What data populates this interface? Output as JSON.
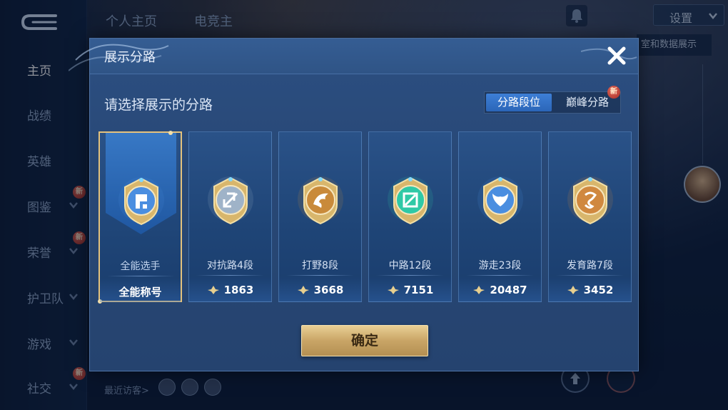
{
  "background": {
    "sidebar": [
      {
        "label": "主页",
        "active": true,
        "chevron": false,
        "badge": ""
      },
      {
        "label": "战绩",
        "active": false,
        "chevron": false,
        "badge": ""
      },
      {
        "label": "英雄",
        "active": false,
        "chevron": false,
        "badge": ""
      },
      {
        "label": "图鉴",
        "active": false,
        "chevron": true,
        "badge": "新"
      },
      {
        "label": "荣誉",
        "active": false,
        "chevron": true,
        "badge": "新"
      },
      {
        "label": "护卫队",
        "active": false,
        "chevron": true,
        "badge": ""
      },
      {
        "label": "游戏",
        "active": false,
        "chevron": true,
        "badge": ""
      },
      {
        "label": "社交",
        "active": false,
        "chevron": true,
        "badge": "新"
      }
    ],
    "top_tabs": [
      "个人主页",
      "电竞主"
    ],
    "settings_label": "设置",
    "peek_label": "室和数据展示",
    "visitors_label": "最近访客>"
  },
  "dialog": {
    "title": "展示分路",
    "subtitle": "请选择展示的分路",
    "toggle": {
      "options": [
        "分路段位",
        "巅峰分路"
      ],
      "selected": "分路段位",
      "badge": "新"
    },
    "cards": [
      {
        "name": "全能选手",
        "value": "全能称号",
        "selected": true,
        "emblem": "all-round-emblem-icon",
        "color": "#4a8ee0"
      },
      {
        "name": "对抗路4段",
        "value": "1863",
        "selected": false,
        "emblem": "clash-lane-emblem-icon",
        "color": "#9fb3c8"
      },
      {
        "name": "打野8段",
        "value": "3668",
        "selected": false,
        "emblem": "jungle-emblem-icon",
        "color": "#c98a3a"
      },
      {
        "name": "中路12段",
        "value": "7151",
        "selected": false,
        "emblem": "mid-lane-emblem-icon",
        "color": "#2fc9a6"
      },
      {
        "name": "游走23段",
        "value": "20487",
        "selected": false,
        "emblem": "roam-emblem-icon",
        "color": "#4a8ee0"
      },
      {
        "name": "发育路7段",
        "value": "3452",
        "selected": false,
        "emblem": "farm-lane-emblem-icon",
        "color": "#d0883f"
      }
    ],
    "confirm_label": "确定"
  },
  "colors": {
    "dialog_bg": "#284876",
    "accent_gold": "#e4c27c",
    "toggle_active": "#3d7fd6"
  }
}
